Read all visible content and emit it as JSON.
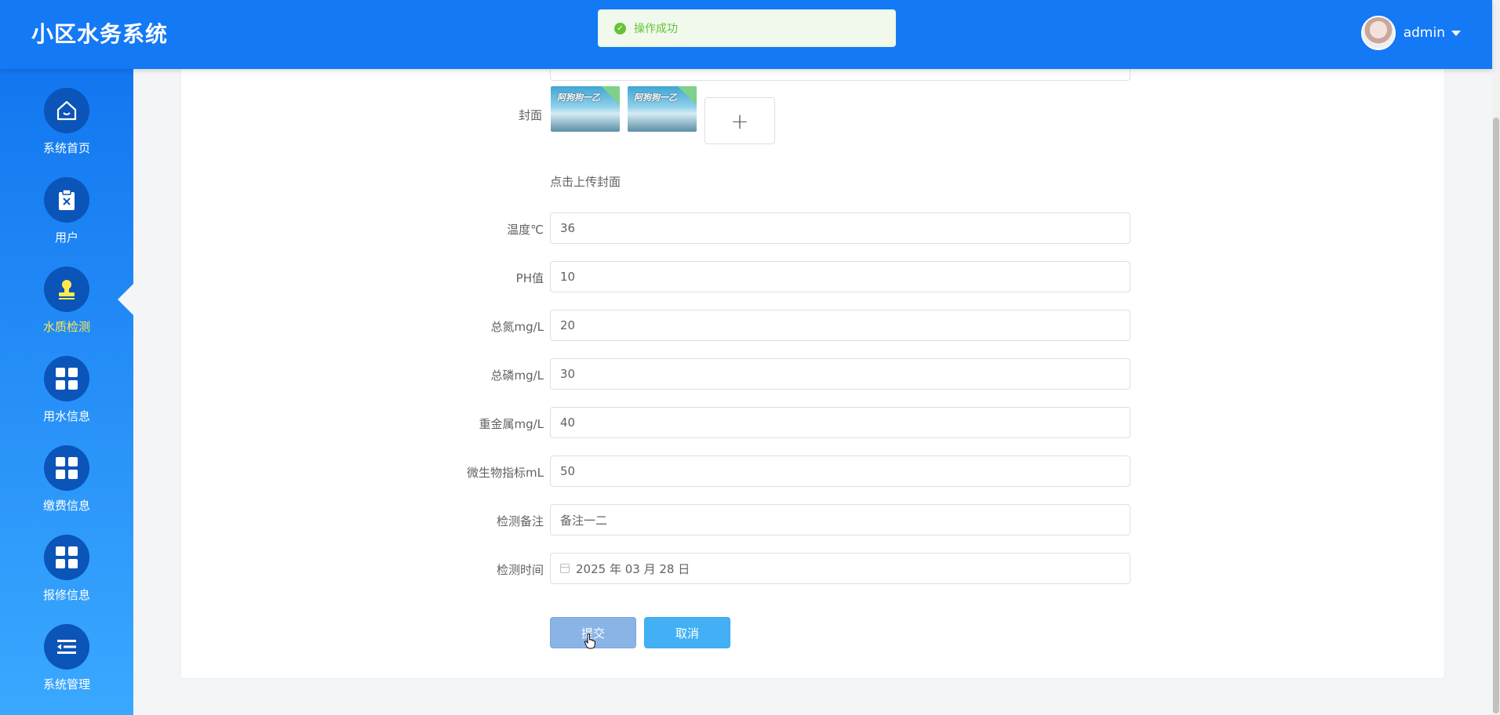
{
  "header": {
    "title": "小区水务系统",
    "username": "admin"
  },
  "toast": {
    "text": "操作成功"
  },
  "sidebar": {
    "items": [
      {
        "label": "系统首页",
        "icon": "home-icon"
      },
      {
        "label": "用户",
        "icon": "clipboard-icon"
      },
      {
        "label": "水质检测",
        "icon": "stamp-icon",
        "active": true
      },
      {
        "label": "用水信息",
        "icon": "grid-icon"
      },
      {
        "label": "缴费信息",
        "icon": "grid-icon"
      },
      {
        "label": "报修信息",
        "icon": "grid-icon"
      },
      {
        "label": "系统管理",
        "icon": "list-icon"
      }
    ]
  },
  "form": {
    "cover_label": "封面",
    "upload_hint": "点击上传封面",
    "thumb_text": "阿狗狗一乙",
    "upload_symbol": "+",
    "fields": [
      {
        "label": "温度℃",
        "value": "36"
      },
      {
        "label": "PH值",
        "value": "10"
      },
      {
        "label": "总氮mg/L",
        "value": "20"
      },
      {
        "label": "总磷mg/L",
        "value": "30"
      },
      {
        "label": "重金属mg/L",
        "value": "40"
      },
      {
        "label": "微生物指标mL",
        "value": "50"
      },
      {
        "label": "检测备注",
        "value": "备注一二"
      },
      {
        "label": "检测时间",
        "value": "2025 年 03 月 28 日"
      }
    ],
    "submit_label": "提交",
    "cancel_label": "取消"
  },
  "colors": {
    "header": "#1479f5",
    "active": "#ffe94b",
    "success": "#67c23a"
  }
}
